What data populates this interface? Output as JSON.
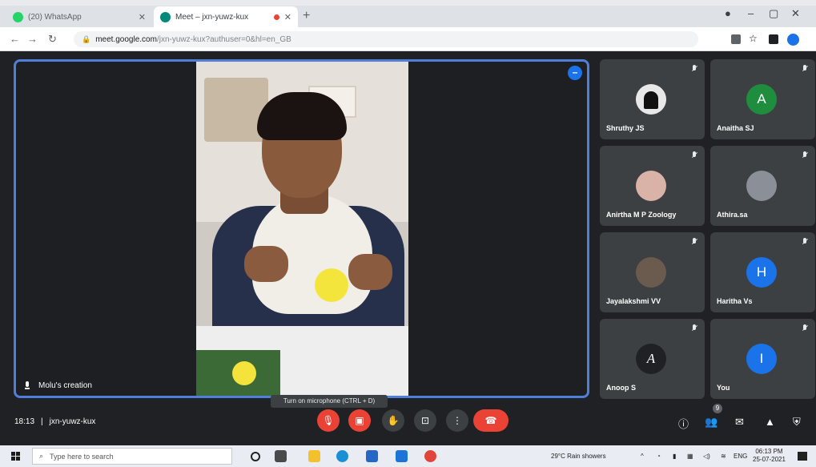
{
  "browser": {
    "tabs": [
      {
        "title": "(20) WhatsApp",
        "active": false,
        "favicon_color": "#25d366"
      },
      {
        "title": "Meet – jxn-yuwz-kux",
        "active": true,
        "favicon_color": "#00897b"
      }
    ],
    "url_host": "meet.google.com",
    "url_path": "/jxn-yuwz-kux?authuser=0&hl=en_GB"
  },
  "meet": {
    "presenter": {
      "name": "Molu's creation"
    },
    "participants": [
      {
        "name": "Shruthy JS",
        "initial": "",
        "avatar_color": "#e8e8e8",
        "type": "photo"
      },
      {
        "name": "Anaitha SJ",
        "initial": "A",
        "avatar_color": "#1e8e3e",
        "type": "letter"
      },
      {
        "name": "Anirtha M P Zoology",
        "initial": "",
        "avatar_color": "#d9b3a8",
        "type": "photo"
      },
      {
        "name": "Athira.sa",
        "initial": "",
        "avatar_color": "#8a8f98",
        "type": "photo"
      },
      {
        "name": "Jayalakshmi VV",
        "initial": "",
        "avatar_color": "#6b5a4e",
        "type": "photo"
      },
      {
        "name": "Haritha Vs",
        "initial": "H",
        "avatar_color": "#1a73e8",
        "type": "letter"
      },
      {
        "name": "Anoop S",
        "initial": "A",
        "avatar_color": "#202124",
        "type": "letter"
      },
      {
        "name": "You",
        "initial": "I",
        "avatar_color": "#1a73e8",
        "type": "letter"
      }
    ],
    "tooltip": "Turn on microphone (CTRL + D)",
    "time": "18:13",
    "meeting_code": "jxn-yuwz-kux",
    "participant_badge": "9"
  },
  "taskbar": {
    "search_placeholder": "Type here to search",
    "weather": "29°C Rain showers",
    "lang": "ENG",
    "time": "06:13 PM",
    "date": "25-07-2021"
  }
}
